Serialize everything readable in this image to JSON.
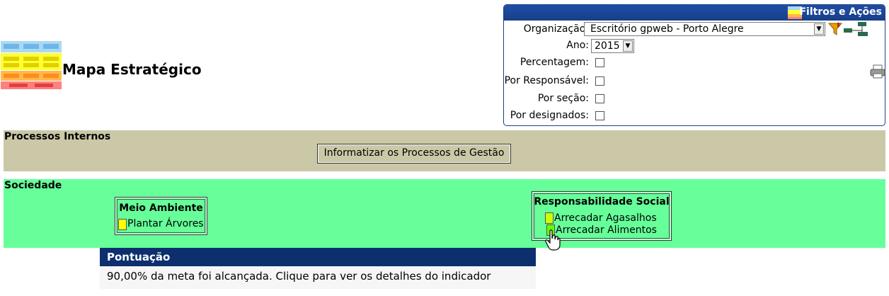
{
  "page": {
    "title": "Mapa Estratégico"
  },
  "filters": {
    "title": "Filtros e Ações",
    "organizacao": {
      "label": "Organização:",
      "value": "Escritório gpweb - Porto Alegre"
    },
    "ano": {
      "label": "Ano:",
      "value": "2015"
    },
    "percentagem": {
      "label": "Percentagem:"
    },
    "por_responsavel": {
      "label": "Por Responsável:"
    },
    "por_secao": {
      "label": "Por seção:"
    },
    "por_designados": {
      "label": "Por designados:"
    }
  },
  "perspectives": [
    {
      "name": "Processos Internos",
      "color": "#cbc8a8",
      "objectives": [
        {
          "title": "Informatizar os Processos de Gestão",
          "indicators": []
        }
      ]
    },
    {
      "name": "Sociedade",
      "color": "#66ff99",
      "objectives": [
        {
          "title": "Meio Ambiente",
          "indicators": [
            {
              "label": "Plantar Árvores",
              "color": "#ffff00"
            }
          ]
        },
        {
          "title": "Responsabilidade Social",
          "indicators": [
            {
              "label": "Arrecadar Agasalhos",
              "color": "#ccff00"
            },
            {
              "label": "Arrecadar Alimentos",
              "color": "#66ff00"
            }
          ]
        }
      ]
    }
  ],
  "tooltip": {
    "title": "Pontuação",
    "text": "90,00% da meta foi alcançada. Clique para ver os detalhes do indicador"
  },
  "icons": [
    "strategic-map-logo-icon",
    "filter-map-icon",
    "funnel-icon",
    "org-chart-icon",
    "printer-icon",
    "hand-cursor-icon"
  ]
}
